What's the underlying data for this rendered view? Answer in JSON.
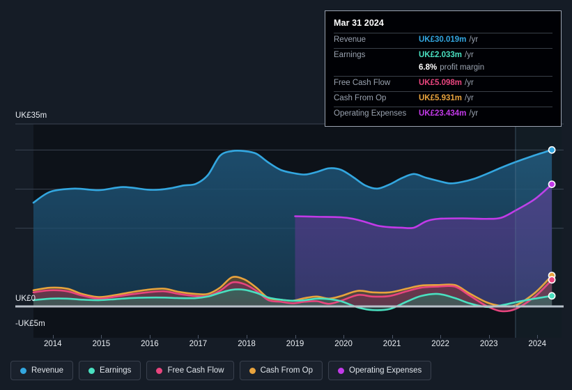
{
  "background": "#151c26",
  "tooltip": {
    "date": "Mar 31 2024",
    "rows": [
      {
        "label": "Revenue",
        "value": "UK£30.019m",
        "unit": "/yr",
        "color": "#33a7e0"
      },
      {
        "label": "Earnings",
        "value": "UK£2.033m",
        "unit": "/yr",
        "color": "#4ae0c0"
      },
      {
        "label": "",
        "value": "6.8%",
        "sub": "profit margin",
        "color": "#ffffff"
      },
      {
        "label": "Free Cash Flow",
        "value": "UK£5.098m",
        "unit": "/yr",
        "color": "#e8457e"
      },
      {
        "label": "Cash From Op",
        "value": "UK£5.931m",
        "unit": "/yr",
        "color": "#e8a33d"
      },
      {
        "label": "Operating Expenses",
        "value": "UK£23.434m",
        "unit": "/yr",
        "color": "#c23ae8"
      }
    ]
  },
  "axis": {
    "y_top_label": "UK£35m",
    "y_zero_label": "UK£0",
    "y_bottom_label": "-UK£5m"
  },
  "legend": [
    {
      "label": "Revenue",
      "color": "#33a7e0"
    },
    {
      "label": "Earnings",
      "color": "#4ae0c0"
    },
    {
      "label": "Free Cash Flow",
      "color": "#e8457e"
    },
    {
      "label": "Cash From Op",
      "color": "#e8a33d"
    },
    {
      "label": "Operating Expenses",
      "color": "#c23ae8"
    }
  ],
  "chart_data": {
    "type": "area",
    "title": "",
    "xlabel": "",
    "ylabel": "",
    "currency": "UK£",
    "unit": "m",
    "ylim": [
      -5,
      35
    ],
    "yticks": [
      -5,
      0,
      35
    ],
    "gridlines": [
      35,
      30,
      22.5,
      15,
      0
    ],
    "grid": true,
    "legend_position": "bottom-left",
    "x": [
      2014,
      2015,
      2016,
      2017,
      2018,
      2019,
      2020,
      2021,
      2022,
      2023,
      2024
    ],
    "tick_labels": [
      "2014",
      "2015",
      "2016",
      "2017",
      "2018",
      "2019",
      "2020",
      "2021",
      "2022",
      "2023",
      "2024"
    ],
    "x_range": [
      2013.6,
      2024.5
    ],
    "forecast_start": 2023.55,
    "series": [
      {
        "name": "Revenue",
        "color": "#33a7e0",
        "fill": "#1d4f70",
        "points": [
          [
            2013.6,
            19.9
          ],
          [
            2013.95,
            22.0
          ],
          [
            2014.45,
            22.6
          ],
          [
            2014.95,
            22.3
          ],
          [
            2015.45,
            22.9
          ],
          [
            2015.95,
            22.4
          ],
          [
            2016.2,
            22.4
          ],
          [
            2016.45,
            22.7
          ],
          [
            2016.7,
            23.2
          ],
          [
            2016.95,
            23.5
          ],
          [
            2017.2,
            25.2
          ],
          [
            2017.45,
            28.9
          ],
          [
            2017.7,
            29.8
          ],
          [
            2017.95,
            29.8
          ],
          [
            2018.2,
            29.3
          ],
          [
            2018.45,
            27.6
          ],
          [
            2018.7,
            26.2
          ],
          [
            2018.95,
            25.6
          ],
          [
            2019.2,
            25.3
          ],
          [
            2019.45,
            25.8
          ],
          [
            2019.7,
            26.5
          ],
          [
            2019.95,
            26.2
          ],
          [
            2020.2,
            24.8
          ],
          [
            2020.45,
            23.2
          ],
          [
            2020.7,
            22.6
          ],
          [
            2020.95,
            23.4
          ],
          [
            2021.2,
            24.6
          ],
          [
            2021.45,
            25.4
          ],
          [
            2021.7,
            24.7
          ],
          [
            2021.95,
            24.1
          ],
          [
            2022.2,
            23.6
          ],
          [
            2022.45,
            23.9
          ],
          [
            2022.7,
            24.5
          ],
          [
            2022.95,
            25.4
          ],
          [
            2023.25,
            26.6
          ],
          [
            2023.55,
            27.7
          ],
          [
            2023.95,
            29.0
          ],
          [
            2024.3,
            30.02
          ]
        ]
      },
      {
        "name": "Operating Expenses",
        "color": "#c23ae8",
        "fill": "#4a3a80",
        "starts_at": 2019.0,
        "points": [
          [
            2019.0,
            17.3
          ],
          [
            2019.45,
            17.2
          ],
          [
            2019.95,
            17.1
          ],
          [
            2020.2,
            16.8
          ],
          [
            2020.45,
            16.2
          ],
          [
            2020.7,
            15.5
          ],
          [
            2020.95,
            15.2
          ],
          [
            2021.2,
            15.1
          ],
          [
            2021.45,
            15.1
          ],
          [
            2021.7,
            16.3
          ],
          [
            2021.95,
            16.8
          ],
          [
            2022.45,
            16.9
          ],
          [
            2022.95,
            16.8
          ],
          [
            2023.25,
            17.0
          ],
          [
            2023.55,
            18.4
          ],
          [
            2023.95,
            20.6
          ],
          [
            2024.3,
            23.43
          ]
        ]
      },
      {
        "name": "Cash From Op",
        "color": "#e8a33d",
        "fill": "#5c4a2e",
        "points": [
          [
            2013.6,
            3.1
          ],
          [
            2013.95,
            3.6
          ],
          [
            2014.3,
            3.4
          ],
          [
            2014.6,
            2.4
          ],
          [
            2014.95,
            1.8
          ],
          [
            2015.3,
            2.2
          ],
          [
            2015.6,
            2.7
          ],
          [
            2015.95,
            3.2
          ],
          [
            2016.3,
            3.4
          ],
          [
            2016.6,
            2.8
          ],
          [
            2016.95,
            2.4
          ],
          [
            2017.2,
            2.4
          ],
          [
            2017.45,
            3.6
          ],
          [
            2017.7,
            5.6
          ],
          [
            2017.95,
            5.2
          ],
          [
            2018.2,
            3.6
          ],
          [
            2018.45,
            1.6
          ],
          [
            2018.7,
            1.3
          ],
          [
            2018.95,
            1.1
          ],
          [
            2019.2,
            1.6
          ],
          [
            2019.45,
            1.9
          ],
          [
            2019.7,
            1.5
          ],
          [
            2019.95,
            2.0
          ],
          [
            2020.3,
            3.0
          ],
          [
            2020.6,
            2.7
          ],
          [
            2020.95,
            2.7
          ],
          [
            2021.3,
            3.4
          ],
          [
            2021.6,
            4.0
          ],
          [
            2021.95,
            4.1
          ],
          [
            2022.3,
            4.1
          ],
          [
            2022.6,
            2.5
          ],
          [
            2022.95,
            0.8
          ],
          [
            2023.25,
            0.1
          ],
          [
            2023.55,
            0.2
          ],
          [
            2023.95,
            2.6
          ],
          [
            2024.3,
            5.931
          ]
        ]
      },
      {
        "name": "Free Cash Flow",
        "color": "#e8457e",
        "fill": "#6b3350",
        "points": [
          [
            2013.6,
            2.7
          ],
          [
            2013.95,
            3.1
          ],
          [
            2014.3,
            2.9
          ],
          [
            2014.6,
            2.1
          ],
          [
            2014.95,
            1.5
          ],
          [
            2015.3,
            1.9
          ],
          [
            2015.6,
            2.3
          ],
          [
            2015.95,
            2.7
          ],
          [
            2016.3,
            2.9
          ],
          [
            2016.6,
            2.4
          ],
          [
            2016.95,
            2.0
          ],
          [
            2017.2,
            2.0
          ],
          [
            2017.45,
            3.0
          ],
          [
            2017.7,
            4.6
          ],
          [
            2017.95,
            4.3
          ],
          [
            2018.2,
            3.0
          ],
          [
            2018.45,
            1.2
          ],
          [
            2018.7,
            0.9
          ],
          [
            2018.95,
            0.6
          ],
          [
            2019.2,
            0.9
          ],
          [
            2019.45,
            1.0
          ],
          [
            2019.7,
            0.5
          ],
          [
            2019.95,
            1.1
          ],
          [
            2020.3,
            2.2
          ],
          [
            2020.6,
            1.9
          ],
          [
            2020.95,
            2.0
          ],
          [
            2021.3,
            2.9
          ],
          [
            2021.6,
            3.6
          ],
          [
            2021.95,
            3.8
          ],
          [
            2022.3,
            3.8
          ],
          [
            2022.6,
            2.1
          ],
          [
            2022.95,
            0.1
          ],
          [
            2023.25,
            -0.9
          ],
          [
            2023.55,
            -0.5
          ],
          [
            2023.95,
            1.9
          ],
          [
            2024.3,
            5.098
          ]
        ]
      },
      {
        "name": "Earnings",
        "color": "#4ae0c0",
        "fill": "#38635c",
        "points": [
          [
            2013.6,
            1.2
          ],
          [
            2013.95,
            1.5
          ],
          [
            2014.3,
            1.5
          ],
          [
            2014.6,
            1.3
          ],
          [
            2014.95,
            1.2
          ],
          [
            2015.3,
            1.4
          ],
          [
            2015.6,
            1.6
          ],
          [
            2015.95,
            1.7
          ],
          [
            2016.3,
            1.7
          ],
          [
            2016.6,
            1.6
          ],
          [
            2016.95,
            1.6
          ],
          [
            2017.2,
            1.9
          ],
          [
            2017.45,
            2.6
          ],
          [
            2017.7,
            3.2
          ],
          [
            2017.95,
            3.2
          ],
          [
            2018.2,
            2.6
          ],
          [
            2018.45,
            1.7
          ],
          [
            2018.7,
            1.3
          ],
          [
            2018.95,
            1.1
          ],
          [
            2019.2,
            1.2
          ],
          [
            2019.45,
            1.5
          ],
          [
            2019.7,
            1.4
          ],
          [
            2019.95,
            1.0
          ],
          [
            2020.3,
            -0.2
          ],
          [
            2020.6,
            -0.7
          ],
          [
            2020.95,
            -0.5
          ],
          [
            2021.3,
            0.9
          ],
          [
            2021.6,
            2.0
          ],
          [
            2021.95,
            2.4
          ],
          [
            2022.3,
            1.6
          ],
          [
            2022.6,
            0.6
          ],
          [
            2022.95,
            -0.1
          ],
          [
            2023.25,
            0.2
          ],
          [
            2023.55,
            0.8
          ],
          [
            2023.95,
            1.5
          ],
          [
            2024.3,
            2.033
          ]
        ]
      }
    ]
  }
}
